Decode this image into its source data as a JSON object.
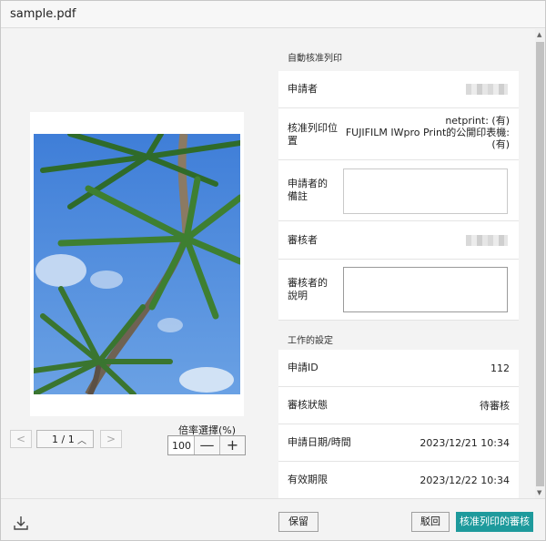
{
  "window": {
    "title": "sample.pdf"
  },
  "preview": {
    "page_indicator": "1 / 1",
    "zoom_label": "倍率選擇(%)",
    "zoom_value": "100",
    "zoom_out": "—",
    "zoom_in": "+",
    "prev": "<",
    "next": ">"
  },
  "panel": {
    "section1_title": "自動核准列印",
    "applicant_label": "申請者",
    "location_label": "核准列印位置",
    "location_value_1": "netprint: (有)",
    "location_value_2": "FUJIFILM IWpro Print的公開印表機:",
    "location_value_3": "(有)",
    "applicant_note_label": "申請者的備註",
    "reviewer_label": "審核者",
    "reviewer_note_label": "審核者的說明",
    "section2_title": "工作的設定",
    "request_id_label": "申請ID",
    "request_id_value": "112",
    "status_label": "審核狀態",
    "status_value": "待審核",
    "request_date_label": "申請日期/時間",
    "request_date_value": "2023/12/21 10:34",
    "expiry_label": "有效期限",
    "expiry_value": "2023/12/22 10:34"
  },
  "footer": {
    "hold_label": "保留",
    "reject_label": "駁回",
    "approve_label": "核准列印的審核"
  },
  "colors": {
    "accent": "#1e9a9c",
    "sky": "#4a86d6"
  }
}
